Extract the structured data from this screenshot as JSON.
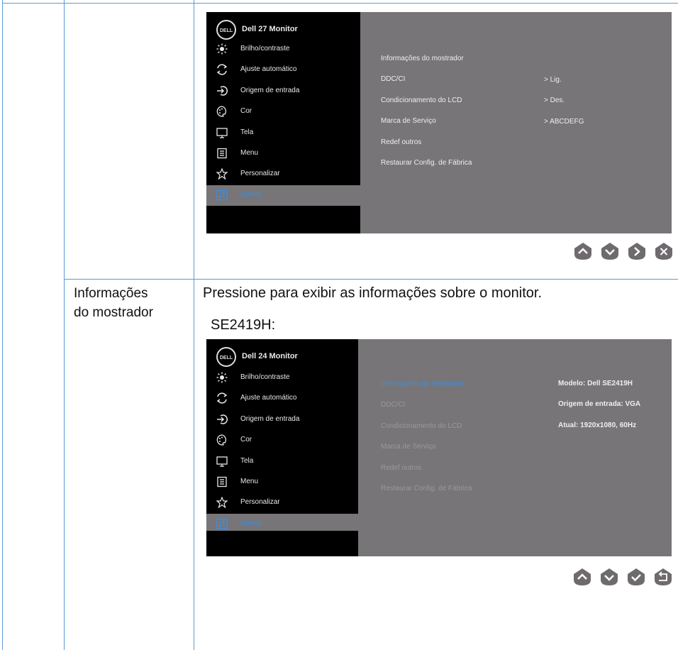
{
  "section_label": [
    "Informações",
    "do mostrador"
  ],
  "description": "Pressione para exibir as informações sobre o monitor.",
  "model_heading": "SE2419H:",
  "osd_top": {
    "logo": "DELL",
    "title": "Dell 27 Monitor",
    "menu": [
      "Brilho/contraste",
      "Ajuste automático",
      "Origem de entrada",
      "Cor",
      "Tela",
      "Menu",
      "Personalizar",
      "Outros"
    ],
    "menu_icons": [
      "brightness-icon",
      "auto-adjust-icon",
      "input-source-icon",
      "color-icon",
      "display-icon",
      "menu-icon",
      "personalize-icon",
      "others-icon"
    ],
    "items": [
      "Informações do mostrador",
      "DDC/CI",
      "Condicionamento do LCD",
      "Marca de Serviço",
      "Redef outros",
      "Restaurar Config. de Fábrica"
    ],
    "values": [
      "> Lig.",
      "> Des.",
      "> ABCDEFG"
    ]
  },
  "osd_bottom": {
    "logo": "DELL",
    "title": "Dell 24 Monitor",
    "menu": [
      "Brilho/contraste",
      "Ajuste automático",
      "Origem de entrada",
      "Cor",
      "Tela",
      "Menu",
      "Personalizar",
      "Outros"
    ],
    "items": [
      "Informações do mostrador",
      "DDC/CI",
      "Condicionamento do LCD",
      "Marca de Serviço",
      "Redef outros",
      "Restaurar Config. de Fábrica"
    ],
    "info": [
      "Modelo: Dell SE2419H",
      "Origem de entrada: VGA",
      "Atual: 1920x1080, 60Hz"
    ]
  },
  "buttons_top": [
    "up-icon",
    "down-icon",
    "right-icon",
    "close-icon"
  ],
  "buttons_bottom": [
    "up-icon",
    "down-icon",
    "check-icon",
    "back-icon"
  ],
  "colors": {
    "table_border": "#5b9bd5",
    "osd_gray": "#777577",
    "osd_black": "#000000",
    "highlight": "#3b8ee6",
    "button": "#6e6a6d"
  }
}
